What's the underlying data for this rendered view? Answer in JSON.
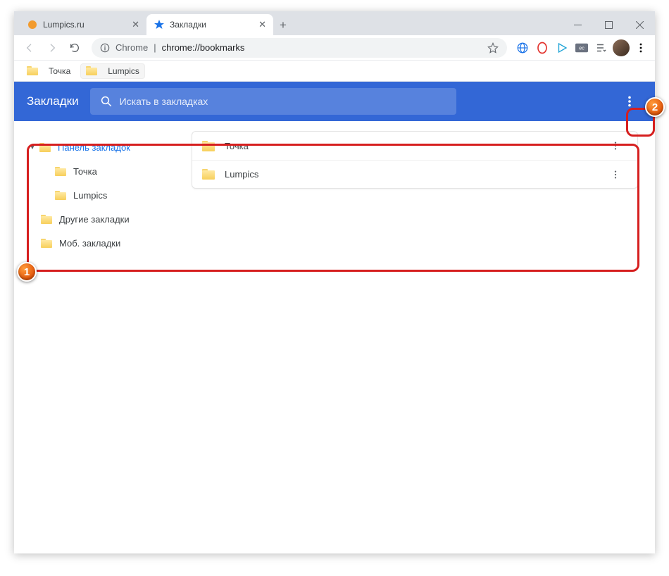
{
  "tabs": [
    {
      "title": "Lumpics.ru",
      "active": false,
      "favicon": "orange-dot"
    },
    {
      "title": "Закладки",
      "active": true,
      "favicon": "blue-star"
    }
  ],
  "omnibox": {
    "prefix": "Chrome",
    "separator": " | ",
    "path": "chrome://bookmarks"
  },
  "bookmarks_bar": [
    {
      "label": "Точка"
    },
    {
      "label": "Lumpics"
    }
  ],
  "page": {
    "title": "Закладки",
    "search_placeholder": "Искать в закладках"
  },
  "tree": [
    {
      "label": "Панель закладок",
      "level": 0,
      "selected": true,
      "expandable": true
    },
    {
      "label": "Точка",
      "level": 1,
      "selected": false,
      "expandable": false
    },
    {
      "label": "Lumpics",
      "level": 1,
      "selected": false,
      "expandable": false
    },
    {
      "label": "Другие закладки",
      "level": 0,
      "selected": false,
      "expandable": false
    },
    {
      "label": "Моб. закладки",
      "level": 0,
      "selected": false,
      "expandable": false
    }
  ],
  "list": [
    {
      "label": "Точка"
    },
    {
      "label": "Lumpics"
    }
  ],
  "annotations": {
    "b1": "1",
    "b2": "2"
  }
}
